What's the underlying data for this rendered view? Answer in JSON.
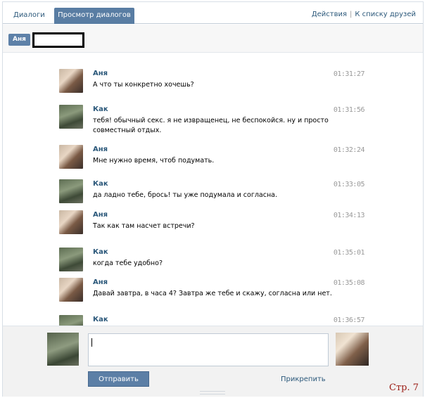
{
  "tabs": [
    {
      "label": "Диалоги"
    },
    {
      "label": "Просмотр диалогов"
    }
  ],
  "top_actions": {
    "actions": "Действия",
    "separator": "|",
    "to_friends": "К списку друзей"
  },
  "conversation": {
    "name_chip": "Аня"
  },
  "messages": [
    {
      "author": "Аня",
      "time": "01:31:27",
      "text": "А что ты конкретно хочешь?",
      "avatar": "anya"
    },
    {
      "author": "Как",
      "time": "01:31:56",
      "text": "тебя! обычный секс. я не извращенец, не беспокойся. ну и просто совместный отдых.",
      "avatar": "kak"
    },
    {
      "author": "Аня",
      "time": "01:32:24",
      "text": "Мне нужно время, чтоб подумать.",
      "avatar": "anya"
    },
    {
      "author": "Как",
      "time": "01:33:05",
      "text": "да ладно тебе, брось! ты уже подумала и согласна.",
      "avatar": "kak"
    },
    {
      "author": "Аня",
      "time": "01:34:13",
      "text": "Так как там насчет встречи?",
      "avatar": "anya"
    },
    {
      "author": "Как",
      "time": "01:35:01",
      "text": "когда тебе удобно?",
      "avatar": "kak"
    },
    {
      "author": "Аня",
      "time": "01:35:08",
      "text": "Давай завтра, в часа 4? Завтра же тебе и скажу, согласна или нет.",
      "avatar": "anya"
    },
    {
      "author": "Как",
      "time": "01:36:57",
      "text": "",
      "avatar": "kak"
    }
  ],
  "composer": {
    "input_value": "",
    "send_label": "Отправить",
    "attach_label": "Прикрепить"
  },
  "page_mark": "Стр. 7",
  "colors": {
    "accent": "#597da3",
    "link": "#2b587a",
    "time": "#999999",
    "page_mark": "#9a1a12"
  }
}
